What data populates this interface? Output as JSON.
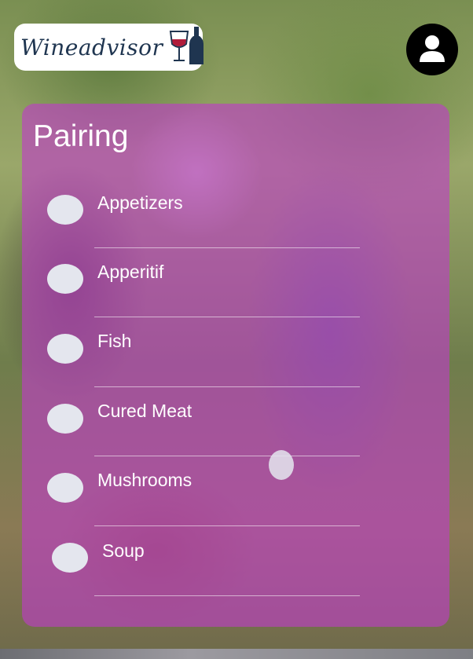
{
  "brand": {
    "name": "Wineadvisor",
    "icon": "wine-glass-and-bottle-icon",
    "bottle_color": "#1f3550",
    "wine_color": "#b01c3a"
  },
  "profile": {
    "icon": "user-icon"
  },
  "panel": {
    "title": "Pairing",
    "background": "#be3cc8",
    "items": [
      {
        "label": "Appetizers"
      },
      {
        "label": "Apperitif"
      },
      {
        "label": "Fish"
      },
      {
        "label": "Cured Meat"
      },
      {
        "label": "Mushrooms"
      },
      {
        "label": "Soup"
      }
    ]
  }
}
